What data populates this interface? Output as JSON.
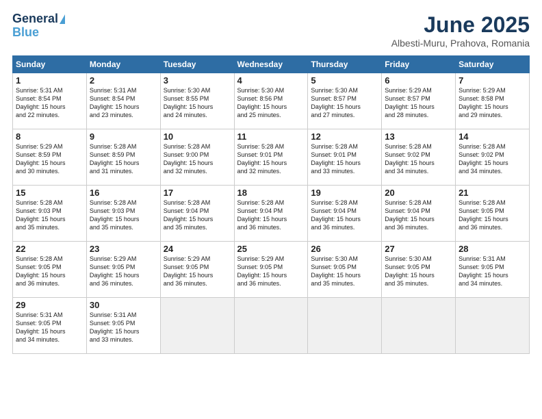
{
  "logo": {
    "line1": "General",
    "line2": "Blue"
  },
  "title": "June 2025",
  "location": "Albesti-Muru, Prahova, Romania",
  "weekdays": [
    "Sunday",
    "Monday",
    "Tuesday",
    "Wednesday",
    "Thursday",
    "Friday",
    "Saturday"
  ],
  "weeks": [
    [
      {
        "day": 1,
        "rise": "5:31 AM",
        "set": "8:54 PM",
        "hours": 15,
        "mins": 22
      },
      {
        "day": 2,
        "rise": "5:31 AM",
        "set": "8:54 PM",
        "hours": 15,
        "mins": 23
      },
      {
        "day": 3,
        "rise": "5:30 AM",
        "set": "8:55 PM",
        "hours": 15,
        "mins": 24
      },
      {
        "day": 4,
        "rise": "5:30 AM",
        "set": "8:56 PM",
        "hours": 15,
        "mins": 25
      },
      {
        "day": 5,
        "rise": "5:30 AM",
        "set": "8:57 PM",
        "hours": 15,
        "mins": 27
      },
      {
        "day": 6,
        "rise": "5:29 AM",
        "set": "8:57 PM",
        "hours": 15,
        "mins": 28
      },
      {
        "day": 7,
        "rise": "5:29 AM",
        "set": "8:58 PM",
        "hours": 15,
        "mins": 29
      }
    ],
    [
      {
        "day": 8,
        "rise": "5:29 AM",
        "set": "8:59 PM",
        "hours": 15,
        "mins": 30
      },
      {
        "day": 9,
        "rise": "5:28 AM",
        "set": "8:59 PM",
        "hours": 15,
        "mins": 31
      },
      {
        "day": 10,
        "rise": "5:28 AM",
        "set": "9:00 PM",
        "hours": 15,
        "mins": 32
      },
      {
        "day": 11,
        "rise": "5:28 AM",
        "set": "9:01 PM",
        "hours": 15,
        "mins": 32
      },
      {
        "day": 12,
        "rise": "5:28 AM",
        "set": "9:01 PM",
        "hours": 15,
        "mins": 33
      },
      {
        "day": 13,
        "rise": "5:28 AM",
        "set": "9:02 PM",
        "hours": 15,
        "mins": 34
      },
      {
        "day": 14,
        "rise": "5:28 AM",
        "set": "9:02 PM",
        "hours": 15,
        "mins": 34
      }
    ],
    [
      {
        "day": 15,
        "rise": "5:28 AM",
        "set": "9:03 PM",
        "hours": 15,
        "mins": 35
      },
      {
        "day": 16,
        "rise": "5:28 AM",
        "set": "9:03 PM",
        "hours": 15,
        "mins": 35
      },
      {
        "day": 17,
        "rise": "5:28 AM",
        "set": "9:04 PM",
        "hours": 15,
        "mins": 35
      },
      {
        "day": 18,
        "rise": "5:28 AM",
        "set": "9:04 PM",
        "hours": 15,
        "mins": 36
      },
      {
        "day": 19,
        "rise": "5:28 AM",
        "set": "9:04 PM",
        "hours": 15,
        "mins": 36
      },
      {
        "day": 20,
        "rise": "5:28 AM",
        "set": "9:04 PM",
        "hours": 15,
        "mins": 36
      },
      {
        "day": 21,
        "rise": "5:28 AM",
        "set": "9:05 PM",
        "hours": 15,
        "mins": 36
      }
    ],
    [
      {
        "day": 22,
        "rise": "5:28 AM",
        "set": "9:05 PM",
        "hours": 15,
        "mins": 36
      },
      {
        "day": 23,
        "rise": "5:29 AM",
        "set": "9:05 PM",
        "hours": 15,
        "mins": 36
      },
      {
        "day": 24,
        "rise": "5:29 AM",
        "set": "9:05 PM",
        "hours": 15,
        "mins": 36
      },
      {
        "day": 25,
        "rise": "5:29 AM",
        "set": "9:05 PM",
        "hours": 15,
        "mins": 36
      },
      {
        "day": 26,
        "rise": "5:30 AM",
        "set": "9:05 PM",
        "hours": 15,
        "mins": 35
      },
      {
        "day": 27,
        "rise": "5:30 AM",
        "set": "9:05 PM",
        "hours": 15,
        "mins": 35
      },
      {
        "day": 28,
        "rise": "5:31 AM",
        "set": "9:05 PM",
        "hours": 15,
        "mins": 34
      }
    ],
    [
      {
        "day": 29,
        "rise": "5:31 AM",
        "set": "9:05 PM",
        "hours": 15,
        "mins": 34
      },
      {
        "day": 30,
        "rise": "5:31 AM",
        "set": "9:05 PM",
        "hours": 15,
        "mins": 33
      },
      null,
      null,
      null,
      null,
      null
    ]
  ]
}
